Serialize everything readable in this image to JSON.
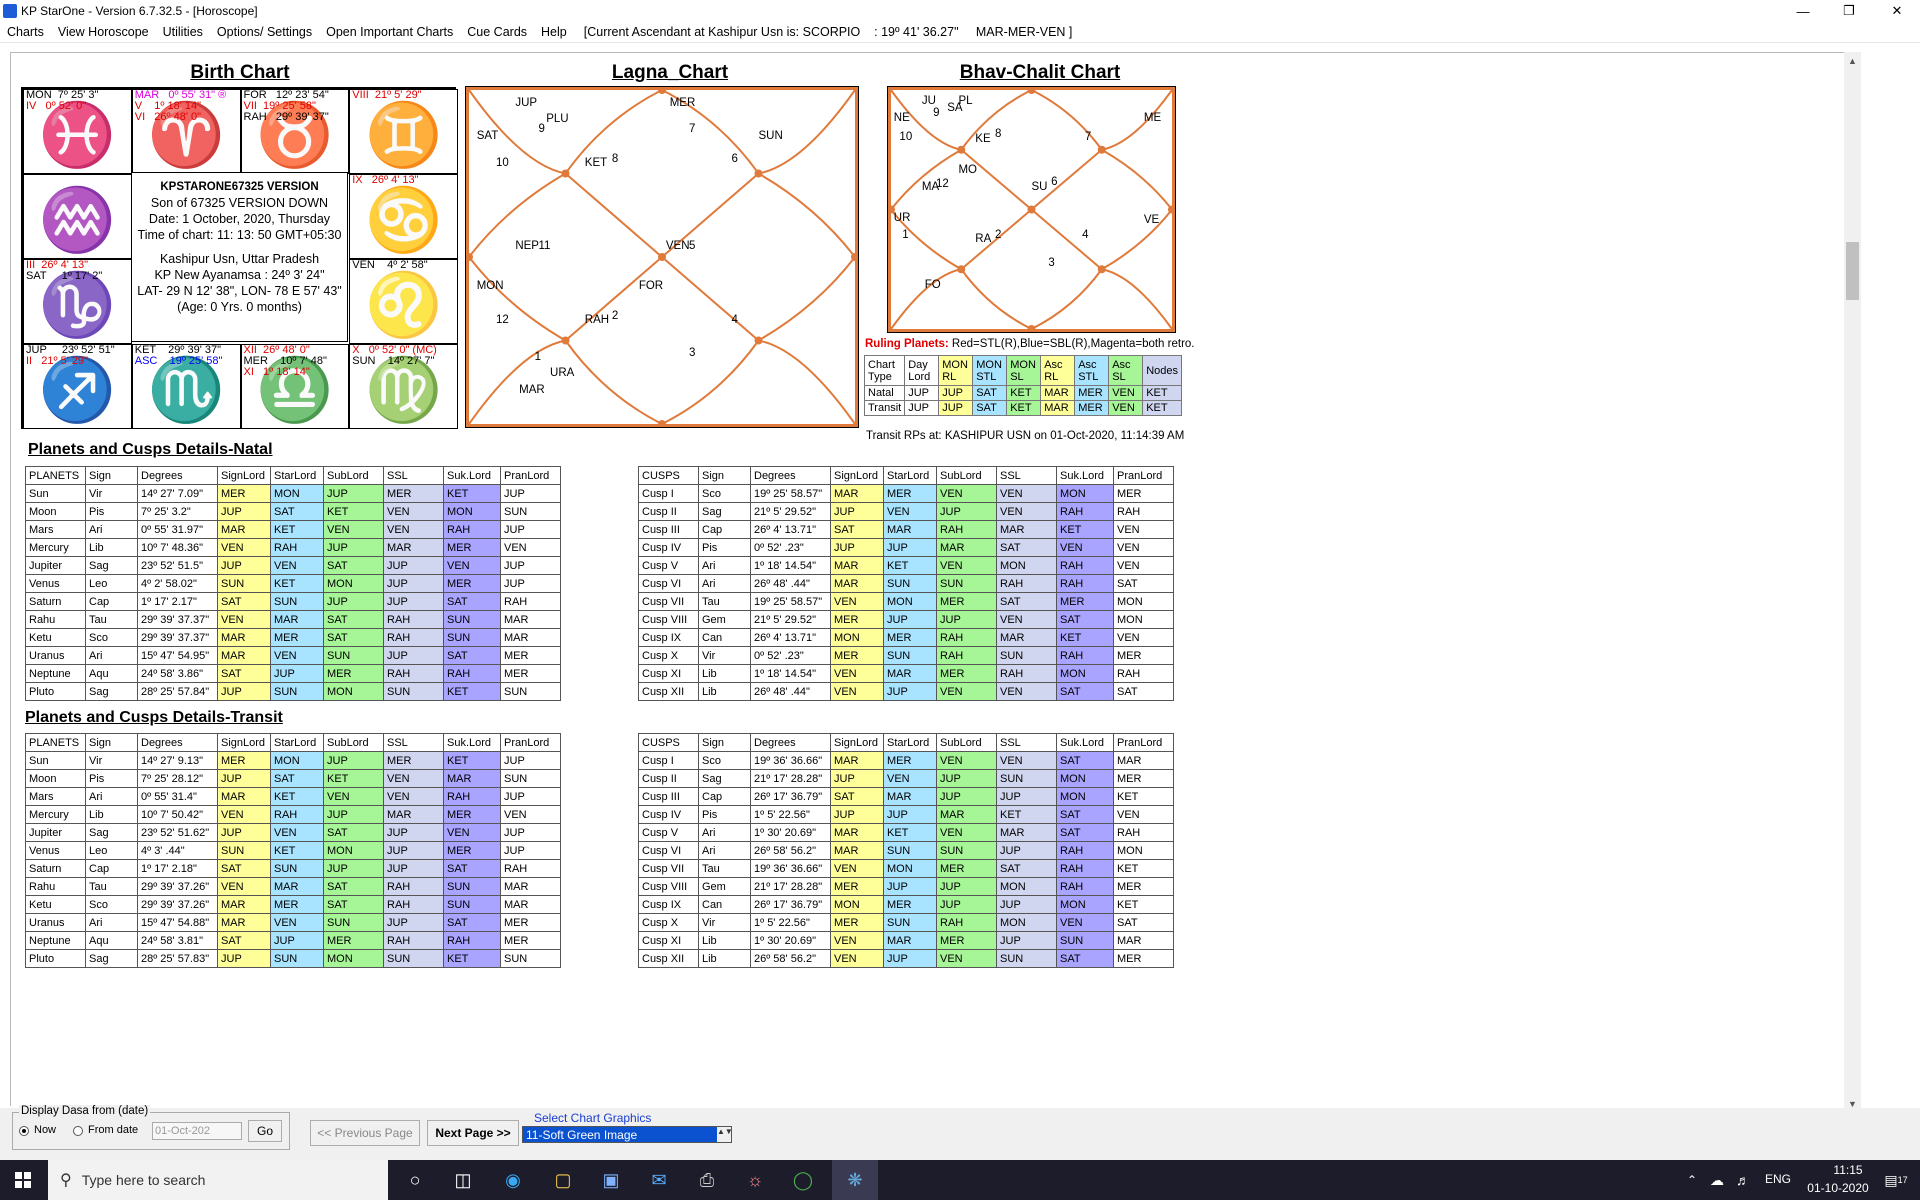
{
  "window": {
    "title": "KP StarOne - Version 6.7.32.5 - [Horoscope]"
  },
  "menu": {
    "items": [
      "Charts",
      "View Horoscope",
      "Utilities",
      "Options/ Settings",
      "Open Important Charts",
      "Cue Cards",
      "Help"
    ],
    "status": "[Current Ascendant at Kashipur Usn is: SCORPIO    : 19º 41' 36.27\"     MAR-MER-VEN ]"
  },
  "birth_chart": {
    "title": "Birth Chart",
    "center": {
      "line1": "KPSTARONE67325 VERSION",
      "line2": "Son of 67325 VERSION DOWN",
      "line3": "Date: 1 October, 2020, Thursday",
      "line4": "Time of chart:  11: 13: 50 GMT+05:30",
      "line5": "Kashipur Usn, Uttar Pradesh",
      "line6": "KP New Ayanamsa : 24º 3' 24\"",
      "line7": "LAT- 29 N 12' 38\", LON- 78 E 57' 43\"",
      "line8": "(Age: 0 Yrs.  0 months)"
    },
    "cells": [
      {
        "sign": "♓",
        "lines": [
          {
            "t": "MON  7º 25' 3\"",
            "c": ""
          },
          {
            "t": "IV   0º 52' 0\"",
            "c": "red"
          }
        ]
      },
      {
        "sign": "♈",
        "lines": [
          {
            "t": "MAR   0º 55' 31\" ®",
            "c": "mag"
          },
          {
            "t": "V    1º 18' 14\"",
            "c": "red"
          },
          {
            "t": "VI   26º 48' 0\"",
            "c": "red"
          }
        ]
      },
      {
        "sign": "♉",
        "lines": [
          {
            "t": "FOR   12º 23' 54\"",
            "c": ""
          },
          {
            "t": "VII  19º 25' 58\"",
            "c": "red"
          },
          {
            "t": "RAH   29º 39' 37\"",
            "c": ""
          }
        ]
      },
      {
        "sign": "♊",
        "lines": [
          {
            "t": "VIII  21º 5' 29\"",
            "c": "red"
          }
        ]
      },
      {
        "sign": "♒",
        "lines": []
      },
      {
        "sign": "♋",
        "lines": [
          {
            "t": "IX   26º 4' 13\"",
            "c": "red"
          }
        ]
      },
      {
        "sign": "♑",
        "lines": [
          {
            "t": "III  26º 4' 13\"",
            "c": "red"
          },
          {
            "t": "SAT     1º 17' 2\"",
            "c": ""
          }
        ]
      },
      {
        "sign": "♌",
        "lines": [
          {
            "t": "VEN    4º 2' 58\"",
            "c": ""
          }
        ]
      },
      {
        "sign": "♐",
        "lines": [
          {
            "t": "JUP     23º 52' 51\"",
            "c": ""
          },
          {
            "t": "II   21º 5' 29\"",
            "c": "red"
          }
        ]
      },
      {
        "sign": "♏",
        "lines": [
          {
            "t": "KET    29º 39' 37\"",
            "c": ""
          },
          {
            "t": "ASC    19º 25' 58\"",
            "c": "blu"
          }
        ]
      },
      {
        "sign": "♎",
        "lines": [
          {
            "t": "XII  26º 48' 0\"",
            "c": "red"
          },
          {
            "t": "MER    10º 7' 48\"",
            "c": ""
          },
          {
            "t": "XI   1º 18' 14\"",
            "c": "red"
          }
        ]
      },
      {
        "sign": "♍",
        "lines": [
          {
            "t": "X   0º 52' 0\" (MC)",
            "c": "red"
          },
          {
            "t": "SUN    14º 27' 7\"",
            "c": ""
          }
        ]
      }
    ]
  },
  "lagna": {
    "title": "Lagna_Chart",
    "labels": [
      "JUP",
      "PLU",
      "9",
      "MER",
      "7",
      "SAT",
      "10",
      "KET",
      "8",
      "6",
      "SUN",
      "NEP",
      "11",
      "VEN",
      "5",
      "MON",
      "FOR",
      "12",
      "RAH",
      "2",
      "4",
      "1",
      "URA",
      "3",
      "MAR"
    ]
  },
  "bhav": {
    "title": "Bhav-Chalit  Chart",
    "labels": [
      "JU",
      "PL",
      "9",
      "SA",
      "NE",
      "10",
      "KE",
      "8",
      "ME",
      "7",
      "MO",
      "MA",
      "12",
      "SU",
      "6",
      "UR",
      "1",
      "RA",
      "2",
      "VE",
      "4",
      "3",
      "FO"
    ]
  },
  "ruling": {
    "label": "Ruling Planets:",
    "legend": "Red=STL(R),Blue=SBL(R),Magenta=both retro.",
    "header": [
      "Chart Type",
      "Day Lord",
      "MON RL",
      "MON STL",
      "MON SL",
      "Asc RL",
      "Asc STL",
      "Asc SL",
      "Nodes"
    ],
    "rows": [
      [
        "Natal",
        "JUP",
        "JUP",
        "SAT",
        "KET",
        "MAR",
        "MER",
        "VEN",
        "KET"
      ],
      [
        "Transit",
        "JUP",
        "JUP",
        "SAT",
        "KET",
        "MAR",
        "MER",
        "VEN",
        "KET"
      ]
    ],
    "transit_rps": "Transit RPs at: KASHIPUR USN on 01-Oct-2020, 11:14:39 AM"
  },
  "natal": {
    "title": "Planets and Cusps Details-Natal",
    "planet_header": [
      "PLANETS",
      "Sign",
      "Degrees",
      "SignLord",
      "StarLord",
      "SubLord",
      "SSL",
      "Suk.Lord",
      "PranLord"
    ],
    "planets": [
      [
        "Sun",
        "Vir",
        "14º 27'  7.09\"",
        "MER",
        "MON",
        "JUP",
        "MER",
        "KET",
        "JUP"
      ],
      [
        "Moon",
        "Pis",
        "7º 25'  3.2\"",
        "JUP",
        "SAT",
        "KET",
        "VEN",
        "MON",
        "SUN"
      ],
      [
        "Mars",
        "Ari",
        "0º 55' 31.97\"",
        "MAR",
        "KET",
        "VEN",
        "VEN",
        "RAH",
        "JUP"
      ],
      [
        "Mercury",
        "Lib",
        "10º 7' 48.36\"",
        "VEN",
        "RAH",
        "JUP",
        "MAR",
        "MER",
        "VEN"
      ],
      [
        "Jupiter",
        "Sag",
        "23º 52' 51.5\"",
        "JUP",
        "VEN",
        "SAT",
        "JUP",
        "VEN",
        "JUP"
      ],
      [
        "Venus",
        "Leo",
        "4º 2' 58.02\"",
        "SUN",
        "KET",
        "MON",
        "JUP",
        "MER",
        "JUP"
      ],
      [
        "Saturn",
        "Cap",
        "1º 17'  2.17\"",
        "SAT",
        "SUN",
        "JUP",
        "JUP",
        "SAT",
        "RAH"
      ],
      [
        "Rahu",
        "Tau",
        "29º 39' 37.37\"",
        "VEN",
        "MAR",
        "SAT",
        "RAH",
        "SUN",
        "MAR"
      ],
      [
        "Ketu",
        "Sco",
        "29º 39' 37.37\"",
        "MAR",
        "MER",
        "SAT",
        "RAH",
        "SUN",
        "MAR"
      ],
      [
        "Uranus",
        "Ari",
        "15º 47' 54.95\"",
        "MAR",
        "VEN",
        "SUN",
        "JUP",
        "SAT",
        "MER"
      ],
      [
        "Neptune",
        "Aqu",
        "24º 58'  3.86\"",
        "SAT",
        "JUP",
        "MER",
        "RAH",
        "RAH",
        "MER"
      ],
      [
        "Pluto",
        "Sag",
        "28º 25' 57.84\"",
        "JUP",
        "SUN",
        "MON",
        "SUN",
        "KET",
        "SUN"
      ]
    ],
    "cusp_header": [
      "CUSPS",
      "Sign",
      "Degrees",
      "SignLord",
      "StarLord",
      "SubLord",
      "SSL",
      "Suk.Lord",
      "PranLord"
    ],
    "cusps": [
      [
        "Cusp I",
        "Sco",
        "19º 25' 58.57\"",
        "MAR",
        "MER",
        "VEN",
        "VEN",
        "MON",
        "MER"
      ],
      [
        "Cusp  II",
        "Sag",
        "21º 5' 29.52\"",
        "JUP",
        "VEN",
        "JUP",
        "VEN",
        "RAH",
        "RAH"
      ],
      [
        "Cusp  III",
        "Cap",
        "26º 4' 13.71\"",
        "SAT",
        "MAR",
        "RAH",
        "MAR",
        "KET",
        "VEN"
      ],
      [
        "Cusp  IV",
        "Pis",
        "0º 52'  .23\"",
        "JUP",
        "JUP",
        "MAR",
        "SAT",
        "VEN",
        "VEN"
      ],
      [
        "Cusp  V",
        "Ari",
        "1º 18' 14.54\"",
        "MAR",
        "KET",
        "VEN",
        "MON",
        "RAH",
        "VEN"
      ],
      [
        "Cusp  VI",
        "Ari",
        "26º 48'  .44\"",
        "MAR",
        "SUN",
        "SUN",
        "RAH",
        "RAH",
        "SAT"
      ],
      [
        "Cusp  VII",
        "Tau",
        "19º 25' 58.57\"",
        "VEN",
        "MON",
        "MER",
        "SAT",
        "MER",
        "MON"
      ],
      [
        "Cusp  VIII",
        "Gem",
        "21º 5' 29.52\"",
        "MER",
        "JUP",
        "JUP",
        "VEN",
        "SAT",
        "MON"
      ],
      [
        "Cusp  IX",
        "Can",
        "26º 4' 13.71\"",
        "MON",
        "MER",
        "RAH",
        "MAR",
        "KET",
        "VEN"
      ],
      [
        "Cusp  X",
        "Vir",
        "0º 52'  .23\"",
        "MER",
        "SUN",
        "RAH",
        "SUN",
        "RAH",
        "MER"
      ],
      [
        "Cusp  XI",
        "Lib",
        "1º 18' 14.54\"",
        "VEN",
        "MAR",
        "MER",
        "RAH",
        "MON",
        "RAH"
      ],
      [
        "Cusp  XII",
        "Lib",
        "26º 48'  .44\"",
        "VEN",
        "JUP",
        "VEN",
        "VEN",
        "SAT",
        "SAT"
      ]
    ]
  },
  "transit": {
    "title": "Planets and Cusps Details-Transit",
    "planet_header": [
      "PLANETS",
      "Sign",
      "Degrees",
      "SignLord",
      "StarLord",
      "SubLord",
      "SSL",
      "Suk.Lord",
      "PranLord"
    ],
    "planets": [
      [
        "Sun",
        "Vir",
        "14º 27'  9.13\"",
        "MER",
        "MON",
        "JUP",
        "MER",
        "KET",
        "JUP"
      ],
      [
        "Moon",
        "Pis",
        "7º 25' 28.12\"",
        "JUP",
        "SAT",
        "KET",
        "VEN",
        "MAR",
        "SUN"
      ],
      [
        "Mars",
        "Ari",
        "0º 55' 31.4\"",
        "MAR",
        "KET",
        "VEN",
        "VEN",
        "RAH",
        "JUP"
      ],
      [
        "Mercury",
        "Lib",
        "10º 7' 50.42\"",
        "VEN",
        "RAH",
        "JUP",
        "MAR",
        "MER",
        "VEN"
      ],
      [
        "Jupiter",
        "Sag",
        "23º 52' 51.62\"",
        "JUP",
        "VEN",
        "SAT",
        "JUP",
        "VEN",
        "JUP"
      ],
      [
        "Venus",
        "Leo",
        "4º 3'  .44\"",
        "SUN",
        "KET",
        "MON",
        "JUP",
        "MER",
        "JUP"
      ],
      [
        "Saturn",
        "Cap",
        "1º 17'  2.18\"",
        "SAT",
        "SUN",
        "JUP",
        "JUP",
        "SAT",
        "RAH"
      ],
      [
        "Rahu",
        "Tau",
        "29º 39' 37.26\"",
        "VEN",
        "MAR",
        "SAT",
        "RAH",
        "SUN",
        "MAR"
      ],
      [
        "Ketu",
        "Sco",
        "29º 39' 37.26\"",
        "MAR",
        "MER",
        "SAT",
        "RAH",
        "SUN",
        "MAR"
      ],
      [
        "Uranus",
        "Ari",
        "15º 47' 54.88\"",
        "MAR",
        "VEN",
        "SUN",
        "JUP",
        "SAT",
        "MER"
      ],
      [
        "Neptune",
        "Aqu",
        "24º 58'  3.81\"",
        "SAT",
        "JUP",
        "MER",
        "RAH",
        "RAH",
        "MER"
      ],
      [
        "Pluto",
        "Sag",
        "28º 25' 57.83\"",
        "JUP",
        "SUN",
        "MON",
        "SUN",
        "KET",
        "SUN"
      ]
    ],
    "cusp_header": [
      "CUSPS",
      "Sign",
      "Degrees",
      "SignLord",
      "StarLord",
      "SubLord",
      "SSL",
      "Suk.Lord",
      "PranLord"
    ],
    "cusps": [
      [
        "Cusp I",
        "Sco",
        "19º 36' 36.66\"",
        "MAR",
        "MER",
        "VEN",
        "VEN",
        "SAT",
        "MAR"
      ],
      [
        "Cusp  II",
        "Sag",
        "21º 17' 28.28\"",
        "JUP",
        "VEN",
        "JUP",
        "SUN",
        "MON",
        "MER"
      ],
      [
        "Cusp  III",
        "Cap",
        "26º 17' 36.79\"",
        "SAT",
        "MAR",
        "JUP",
        "JUP",
        "MON",
        "KET"
      ],
      [
        "Cusp  IV",
        "Pis",
        "1º 5' 22.56\"",
        "JUP",
        "JUP",
        "MAR",
        "KET",
        "SAT",
        "VEN"
      ],
      [
        "Cusp  V",
        "Ari",
        "1º 30' 20.69\"",
        "MAR",
        "KET",
        "VEN",
        "MAR",
        "SAT",
        "RAH"
      ],
      [
        "Cusp  VI",
        "Ari",
        "26º 58' 56.2\"",
        "MAR",
        "SUN",
        "SUN",
        "JUP",
        "RAH",
        "MON"
      ],
      [
        "Cusp  VII",
        "Tau",
        "19º 36' 36.66\"",
        "VEN",
        "MON",
        "MER",
        "SAT",
        "RAH",
        "KET"
      ],
      [
        "Cusp  VIII",
        "Gem",
        "21º 17' 28.28\"",
        "MER",
        "JUP",
        "JUP",
        "MON",
        "RAH",
        "MER"
      ],
      [
        "Cusp  IX",
        "Can",
        "26º 17' 36.79\"",
        "MON",
        "MER",
        "JUP",
        "JUP",
        "MON",
        "KET"
      ],
      [
        "Cusp  X",
        "Vir",
        "1º 5' 22.56\"",
        "MER",
        "SUN",
        "RAH",
        "MON",
        "VEN",
        "SAT"
      ],
      [
        "Cusp  XI",
        "Lib",
        "1º 30' 20.69\"",
        "VEN",
        "MAR",
        "MER",
        "JUP",
        "SUN",
        "MAR"
      ],
      [
        "Cusp  XII",
        "Lib",
        "26º 58' 56.2\"",
        "VEN",
        "JUP",
        "VEN",
        "SUN",
        "SAT",
        "MER"
      ]
    ]
  },
  "bottom": {
    "dasa_legend": "Display Dasa from (date)",
    "now": "Now",
    "from_date": "From date",
    "date_value": "01-Oct-202",
    "go": "Go",
    "prev": "<< Previous Page",
    "next": "Next Page >>",
    "select_label": "Select Chart Graphics",
    "select_value": "11-Soft Green Image"
  },
  "taskbar": {
    "search_placeholder": "Type here to search",
    "lang": "ENG",
    "time": "11:15",
    "date": "01-10-2020",
    "notif": "17"
  }
}
